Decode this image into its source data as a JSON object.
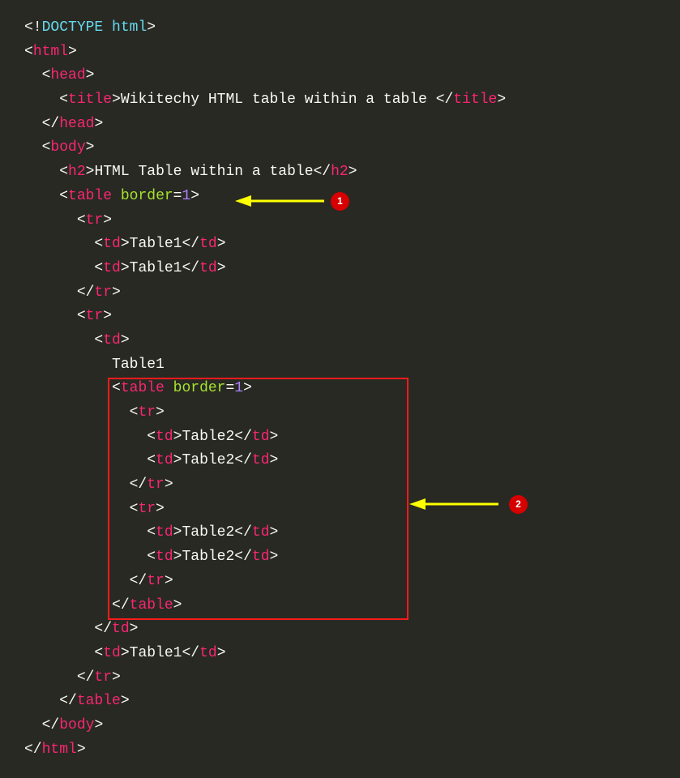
{
  "colors": {
    "background": "#282923",
    "punctuation": "#f8f8f2",
    "tag": "#f92672",
    "attr": "#a6e22e",
    "doctype": "#66d9ef",
    "text": "#f8f8f2",
    "number": "#ae81ff",
    "highlight_border": "#ff1b1b",
    "arrow_body": "#ffff00",
    "badge_bg": "#d60000",
    "badge_fg": "#ffffff"
  },
  "annotations": {
    "badge1": "1",
    "badge2": "2"
  },
  "code": {
    "doctype_lt": "<!",
    "doctype_kw": "DOCTYPE",
    "doctype_rest": " html",
    "gt": ">",
    "lt": "<",
    "lts": "</",
    "eq": "=",
    "tag_html": "html",
    "tag_head": "head",
    "tag_title": "title",
    "tag_body": "body",
    "tag_h2": "h2",
    "tag_table": "table",
    "tag_tr": "tr",
    "tag_td": "td",
    "attr_border": "border",
    "val_border": "1",
    "title_text": "Wikitechy HTML table within a table ",
    "h2_text": "HTML Table within a table",
    "table1_text": "Table1",
    "table2_text": "Table2",
    "indent1": "  ",
    "indent2": "    ",
    "indent3": "      ",
    "indent4": "        ",
    "indent5": "          ",
    "indent6": "            ",
    "indent7": "              "
  }
}
